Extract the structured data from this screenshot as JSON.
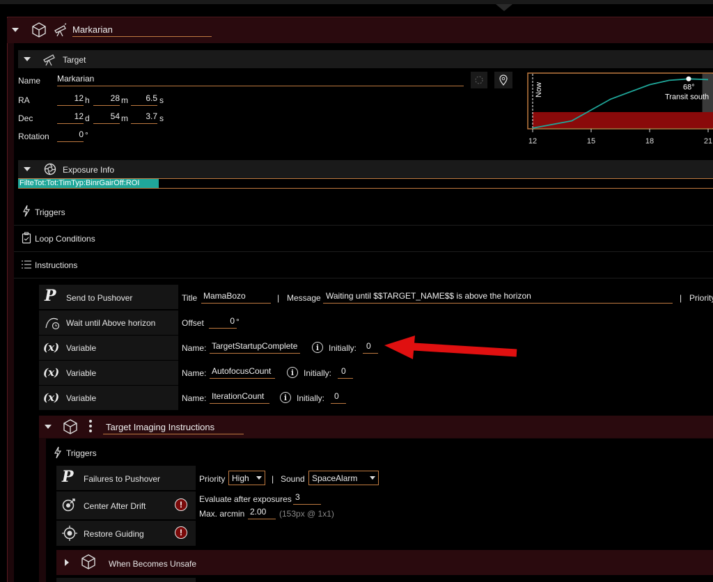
{
  "container": {
    "title": "Markarian"
  },
  "target": {
    "section_label": "Target",
    "name_label": "Name",
    "name_value": "Markarian",
    "ra_label": "RA",
    "ra_h": "12",
    "ra_h_unit": "h",
    "ra_m": "28",
    "ra_m_unit": "m",
    "ra_s": "6.5",
    "ra_s_unit": "s",
    "dec_label": "Dec",
    "dec_d": "12",
    "dec_d_unit": "d",
    "dec_m": "54",
    "dec_m_unit": "m",
    "dec_s": "3.7",
    "dec_s_unit": "s",
    "rotation_label": "Rotation",
    "rotation_value": "0",
    "rotation_unit": "°"
  },
  "chart_data": {
    "type": "line",
    "x_ticks": [
      "12",
      "15",
      "18",
      "21"
    ],
    "now_label": "Now",
    "peak_label": "68°",
    "transit_label": "Transit south",
    "series": [
      {
        "x": [
          12,
          14,
          15,
          16,
          18,
          19,
          20,
          21
        ],
        "y": [
          0,
          10,
          25,
          40,
          60,
          66,
          68,
          67
        ]
      }
    ],
    "colors": {
      "curve": "#1fa79a",
      "horizon": "#8a0a0a",
      "night": "#3a3a3a"
    }
  },
  "exposure": {
    "section_label": "Exposure Info",
    "bar_text": "FilteTot:Tot:TimTyp:BinrGairOff:ROI"
  },
  "sections": {
    "triggers": "Triggers",
    "loop_conditions": "Loop Conditions",
    "instructions": "Instructions"
  },
  "instructions": [
    {
      "name": "Send to Pushover"
    },
    {
      "name": "Wait until Above horizon"
    },
    {
      "name": "Variable"
    },
    {
      "name": "Variable"
    },
    {
      "name": "Variable"
    }
  ],
  "pushover": {
    "title_label": "Title",
    "title_value": "MamaBozo",
    "sep": "|",
    "message_label": "Message",
    "message_value": "Waiting until $$TARGET_NAME$$ is above the horizon",
    "priority_label": "Priority"
  },
  "horizon": {
    "offset_label": "Offset",
    "offset_value": "0",
    "offset_unit": "°"
  },
  "variables": [
    {
      "name_label": "Name:",
      "name": "TargetStartupComplete",
      "initially_label": "Initially:",
      "initially": "0"
    },
    {
      "name_label": "Name:",
      "name": "AutofocusCount",
      "initially_label": "Initially:",
      "initially": "0"
    },
    {
      "name_label": "Name:",
      "name": "IterationCount",
      "initially_label": "Initially:",
      "initially": "0"
    }
  ],
  "imaging": {
    "title": "Target Imaging Instructions",
    "triggers_label": "Triggers",
    "triggers": [
      {
        "name": "Failures to Pushover"
      },
      {
        "name": "Center After Drift",
        "alert": "!"
      },
      {
        "name": "Restore Guiding",
        "alert": "!"
      }
    ],
    "priority_label": "Priority",
    "priority_value": "High",
    "sep": "|",
    "sound_label": "Sound",
    "sound_value": "SpaceAlarm",
    "evaluate_label": "Evaluate after exposures",
    "evaluate_value": "3",
    "arcmin_label": "Max. arcmin",
    "arcmin_value": "2.00",
    "arcmin_note": "(153px @ 1x1)",
    "unsafe_label": "When Becomes Unsafe"
  },
  "annotation": {
    "arrow_color": "#e01010"
  }
}
